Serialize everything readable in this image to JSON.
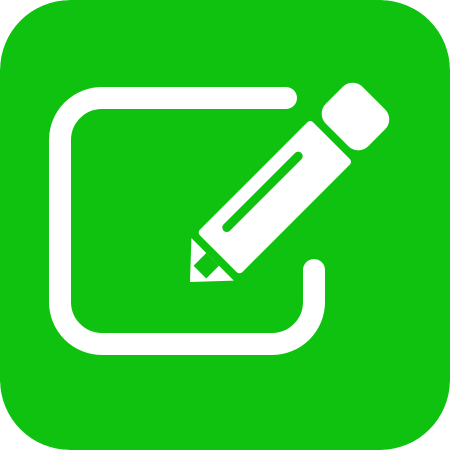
{
  "icon": {
    "name": "compose-edit-icon",
    "background_color": "#0FC20F",
    "foreground_color": "#FFFFFF"
  }
}
